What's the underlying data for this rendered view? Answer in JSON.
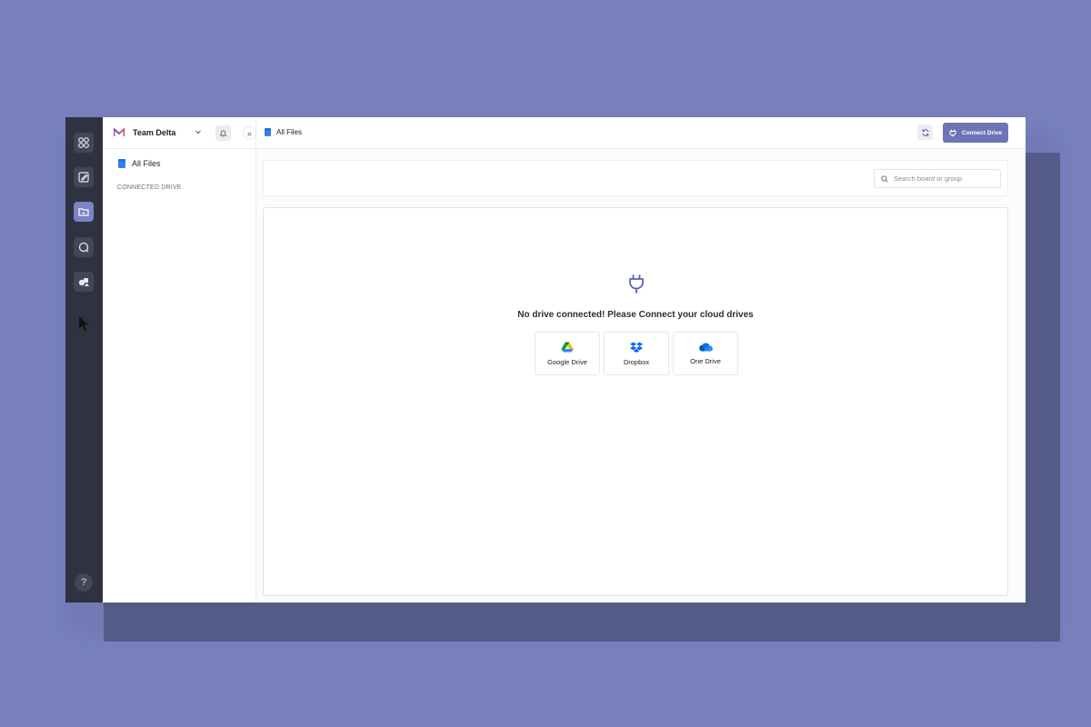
{
  "team": {
    "name": "Team Delta"
  },
  "breadcrumb": {
    "label": "All Files"
  },
  "sidebar": {
    "all_files_label": "All Files",
    "section_label": "CONNECTED DRIVE",
    "collapse_symbol": "«"
  },
  "rail": {
    "help_label": "?"
  },
  "header": {
    "connect_label": "Connect Drive"
  },
  "search": {
    "placeholder": "Search board or group"
  },
  "empty_state": {
    "message": "No drive connected! Please Connect your cloud drives",
    "drives": [
      {
        "label": "Google Drive",
        "icon": "google-drive-icon"
      },
      {
        "label": "Dropbox",
        "icon": "dropbox-icon"
      },
      {
        "label": "One Drive",
        "icon": "onedrive-icon"
      }
    ]
  },
  "colors": {
    "accent": "#6d75b8",
    "rail_bg": "#2f3241",
    "page_bg": "#7780bd",
    "file_icon": "#2f80ed"
  }
}
